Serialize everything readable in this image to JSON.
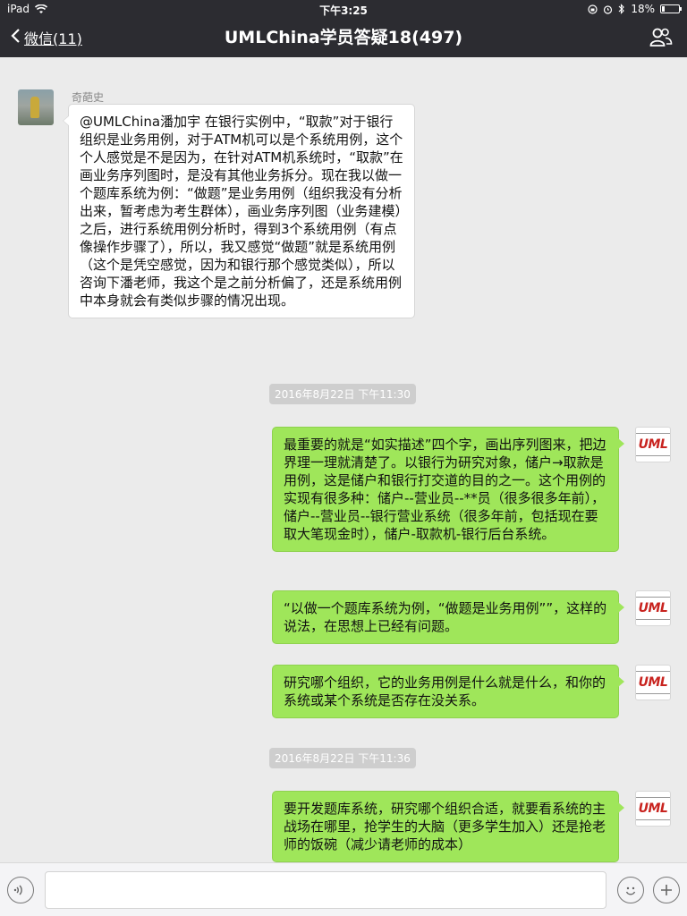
{
  "status_bar": {
    "device": "iPad",
    "time": "下午3:25",
    "battery": "18%",
    "battery_level": 0.18
  },
  "nav": {
    "back_label": "微信(11)",
    "title": "UMLChina学员答疑18(497)"
  },
  "timestamps": {
    "t1": "2016年8月22日 下午11:30",
    "t2": "2016年8月22日 下午11:36"
  },
  "messages": [
    {
      "side": "left",
      "sender": "奇葩史",
      "text": "@UMLChina潘加宇 在银行实例中，“取款”对于银行组织是业务用例，对于ATM机可以是个系统用例，这个个人感觉是不是因为，在针对ATM机系统时，“取款”在画业务序列图时，是没有其他业务拆分。现在我以做一个题库系统为例：“做题”是业务用例（组织我没有分析出来，暂考虑为考生群体），画业务序列图（业务建模）之后，进行系统用例分析时，得到3个系统用例（有点像操作步骤了），所以，我又感觉“做题”就是系统用例（这个是凭空感觉，因为和银行那个感觉类似），所以咨询下潘老师，我这个是之前分析偏了，还是系统用例中本身就会有类似步骤的情况出现。"
    },
    {
      "side": "right",
      "text": "最重要的就是“如实描述”四个字，画出序列图来，把边界理一理就清楚了。以银行为研究对象，储户→取款是用例，这是储户和银行打交道的目的之一。这个用例的实现有很多种：储户--营业员--**员（很多很多年前），储户--营业员--银行营业系统（很多年前，包括现在要取大笔现金时），储户-取款机-银行后台系统。"
    },
    {
      "side": "right",
      "text": "“以做一个题库系统为例，“做题是业务用例””，这样的说法，在思想上已经有问题。"
    },
    {
      "side": "right",
      "text": "研究哪个组织，它的业务用例是什么就是什么，和你的系统或某个系统是否存在没关系。"
    },
    {
      "side": "right",
      "text": "要开发题库系统，研究哪个组织合适，就要看系统的主战场在哪里，抢学生的大脑（更多学生加入）还是抢老师的饭碗（减少请老师的成本）"
    }
  ],
  "avatar_logo_text": "UML",
  "colors": {
    "nav_bg": "#2c2c31",
    "chat_bg": "#ebebeb",
    "bubble_green": "#9fe65a",
    "bubble_white": "#ffffff"
  }
}
